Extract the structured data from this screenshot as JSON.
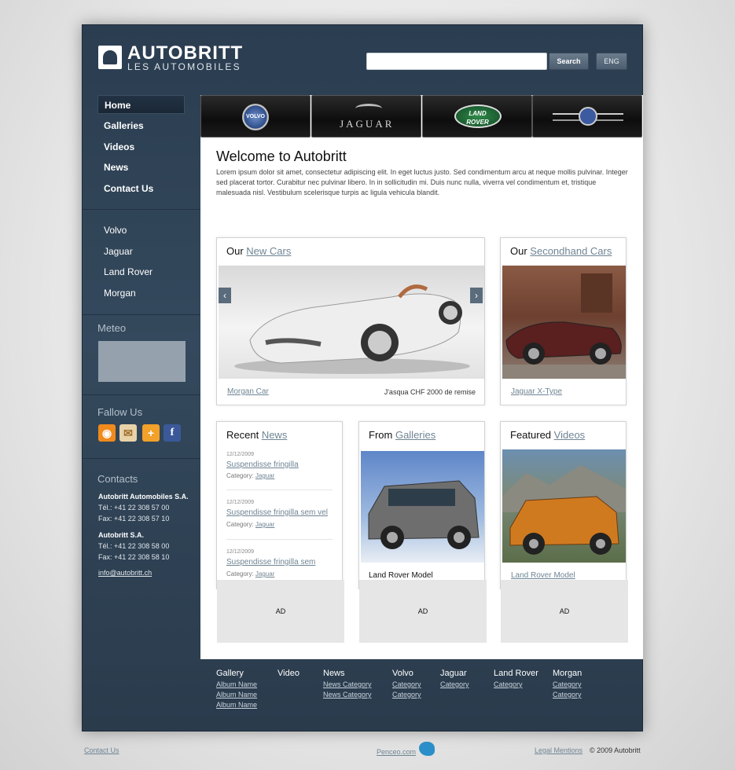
{
  "header": {
    "logo_title": "AUTOBRITT",
    "logo_subtitle": "LES AUTOMOBILES",
    "search_placeholder": "",
    "search_label": "Search",
    "lang_label": "ENG"
  },
  "nav": {
    "items": [
      {
        "label": "Home",
        "active": true
      },
      {
        "label": "Galleries"
      },
      {
        "label": "Videos"
      },
      {
        "label": "News"
      },
      {
        "label": "Contact Us"
      }
    ]
  },
  "brands": {
    "items": [
      "Volvo",
      "Jaguar",
      "Land Rover",
      "Morgan"
    ]
  },
  "brandbar": {
    "volvo": "VOLVO",
    "jaguar": "JAGUAR",
    "landrover_line1": "LAND",
    "landrover_line2": "ROVER"
  },
  "meteo": {
    "heading": "Meteo"
  },
  "follow": {
    "heading": "Fallow Us"
  },
  "contacts": {
    "heading": "Contacts",
    "company1": "Autobritt Automobiles S.A.",
    "tel1": "Tél.: +41 22 308 57 00",
    "fax1": "Fax: +41 22 308 57 10",
    "company2": "Autobritt S.A.",
    "tel2": "Tél.: +41 22 308 58 00",
    "fax2": "Fax: +41 22 308 58 10",
    "email": "info@autobritt.ch"
  },
  "welcome": {
    "title": "Welcome to Autobritt",
    "text": "Lorem ipsum dolor sit amet, consectetur adipiscing elit. In eget luctus justo. Sed condimentum arcu at neque mollis pulvinar. Integer sed placerat tortor. Curabitur nec pulvinar libero. In in sollicitudin mi. Duis nunc nulla, viverra vel condimentum et, tristique malesuada nisl. Vestibulum scelerisque turpis ac ligula vehicula blandit."
  },
  "new_cars": {
    "prefix": "Our ",
    "link": "New Cars",
    "caption_link": "Morgan Car",
    "caption_text": "J'asqua CHF 2000 de remise"
  },
  "secondhand": {
    "prefix": "Our ",
    "link": "Secondhand Cars",
    "caption_link": "Jaguar X-Type"
  },
  "recent_news": {
    "prefix": "Recent ",
    "link": "News",
    "items": [
      {
        "date": "12/12/2009",
        "title": "Suspendisse fringilla",
        "cat_label": "Category: ",
        "cat": "Jaguar"
      },
      {
        "date": "12/12/2009",
        "title": "Suspendisse fringilla sem vel",
        "cat_label": "Category: ",
        "cat": "Jaguar"
      },
      {
        "date": "12/12/2009",
        "title": "Suspendisse fringilla sem",
        "cat_label": "Category: ",
        "cat": "Jaguar"
      }
    ]
  },
  "galleries": {
    "prefix": "From ",
    "link": "Galleries",
    "caption": "Land Rover Model"
  },
  "videos": {
    "prefix": "Featured ",
    "link": "Videos",
    "caption_link": "Land Rover Model"
  },
  "ads": [
    "AD",
    "AD",
    "AD"
  ],
  "footer": {
    "cols": [
      {
        "heading": "Gallery",
        "links": [
          "Album Name",
          "Album Name",
          "Album Name"
        ]
      },
      {
        "heading": "Video",
        "links": []
      },
      {
        "heading": "News",
        "links": [
          "News Category",
          "News Category"
        ]
      },
      {
        "heading": "Volvo",
        "links": [
          "Category",
          "Category"
        ]
      },
      {
        "heading": "Jaguar",
        "links": [
          "Category"
        ]
      },
      {
        "heading": "Land Rover",
        "links": [
          "Category"
        ]
      },
      {
        "heading": "Morgan",
        "links": [
          "Category",
          "Category"
        ]
      }
    ]
  },
  "bottom": {
    "contact": "Contact Us",
    "penceo": "Penceo.com",
    "legal": "Legal Mentions",
    "copyright": "© 2009 Autobritt"
  }
}
